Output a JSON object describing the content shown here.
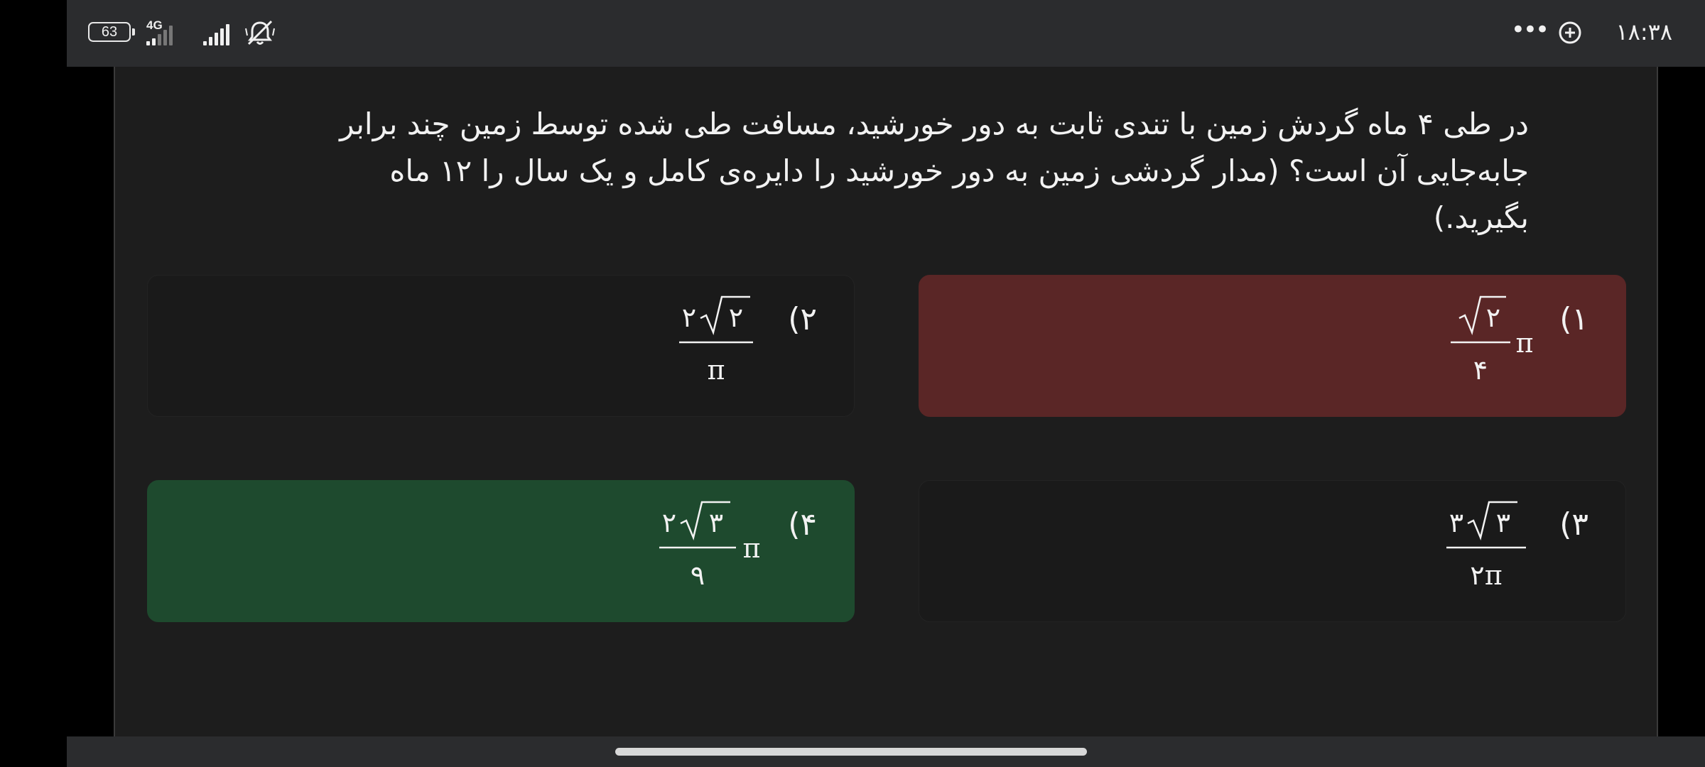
{
  "status_bar": {
    "battery": "63",
    "network": "4G",
    "time": "۱۸:۳۸",
    "icons": [
      "battery-icon",
      "signal-4g-icon",
      "signal-bars-icon",
      "silent-bell-icon",
      "add-circle-icon",
      "more-dots-icon"
    ]
  },
  "question": {
    "text": "در طی ۴ ماه گردش زمین با تندی ثابت به دور خورشید، مسافت طی شده توسط زمین چند برابر جابه‌جایی آن است؟ (مدار گردشی زمین به دور خورشید را دایره‌ی کامل و یک سال را ۱۲ ماه بگیرید.)"
  },
  "options": [
    {
      "label": "۱)",
      "coef": "",
      "radicand": "۲",
      "denominator": "۴",
      "pi_side": "π",
      "state": "wrong"
    },
    {
      "label": "۲)",
      "coef": "۲",
      "radicand": "۲",
      "denominator": "π",
      "pi_side": "",
      "state": "neutral"
    },
    {
      "label": "۳)",
      "coef": "۳",
      "radicand": "۳",
      "denominator": "۲π",
      "pi_side": "",
      "state": "neutral"
    },
    {
      "label": "۴)",
      "coef": "۲",
      "radicand": "۳",
      "denominator": "۹",
      "pi_side": "π",
      "state": "correct"
    }
  ],
  "colors": {
    "wrong": "#5a2626",
    "correct": "#1e4a2e",
    "neutral": "#1a1a1a",
    "background": "#1d1d1d"
  }
}
